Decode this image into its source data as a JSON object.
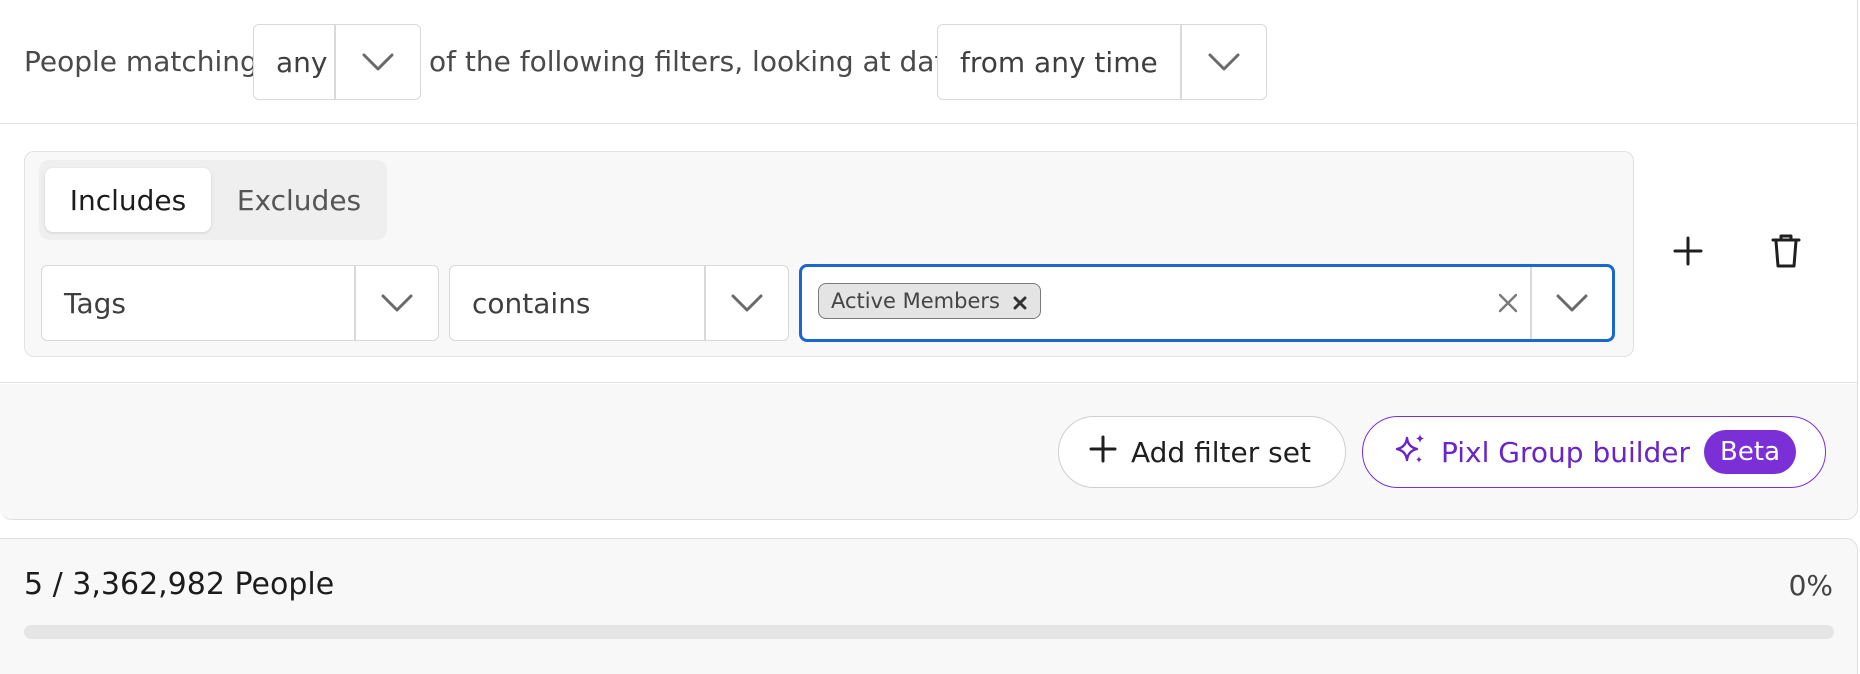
{
  "header": {
    "prefix_text": "People matching",
    "match_mode": {
      "value": "any"
    },
    "middle_text": "of the following filters, looking at data",
    "time_range": {
      "value": "from any time"
    }
  },
  "filter_set": {
    "tabs": [
      {
        "label": "Includes",
        "active": true
      },
      {
        "label": "Excludes",
        "active": false
      }
    ],
    "rule": {
      "field": "Tags",
      "operator": "contains",
      "selected_values": [
        "Active Members"
      ]
    },
    "icons": {
      "add": "plus-icon",
      "delete": "trash-icon",
      "clear": "close-icon",
      "chevron": "chevron-down-icon",
      "chip_remove": "close-icon"
    }
  },
  "actions": {
    "add_filter_set_label": "Add filter set",
    "pixl_label": "Pixl Group builder",
    "beta_badge": "Beta",
    "pixl_icon": "sparkles-icon"
  },
  "results": {
    "count_text": "5 / 3,362,982 People",
    "percent_text": "0%",
    "progress_fraction": 0.0
  },
  "colors": {
    "accent_purple": "#7b2fd6",
    "focus_blue": "#1a66d2",
    "border_gray": "#d9d9d9"
  }
}
